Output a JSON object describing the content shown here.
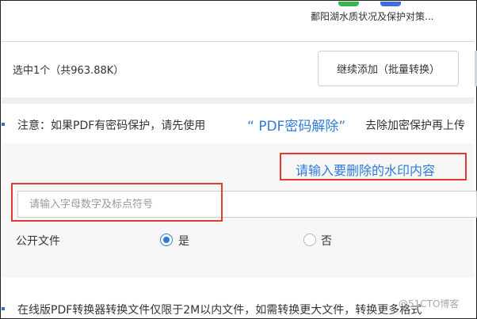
{
  "file": {
    "name": "鄱阳湖水质状况及保护对策..."
  },
  "selection": {
    "status": "选中1个（共963.88K）",
    "continue_button": "继续添加（批量转换）"
  },
  "notice": {
    "prefix": "注意：如果PDF有密码保护，请先使用",
    "link": "“ PDF密码解除”",
    "suffix": "去除加密保护再上传"
  },
  "form": {
    "watermark_label": "请输入要删除的水印内容",
    "watermark_placeholder": "请输入字母数字及标点符号",
    "public_label": "公开文件",
    "option_yes": "是",
    "option_no": "否",
    "selected": "是"
  },
  "footer": {
    "text": "在线版PDF转换器转换文件仅限于2M以内文件，如需转换更大文件，转换更多格式"
  },
  "watermark_text": "@51CTO博客",
  "colors": {
    "link": "#2f7bd6",
    "highlight": "#e53935"
  }
}
